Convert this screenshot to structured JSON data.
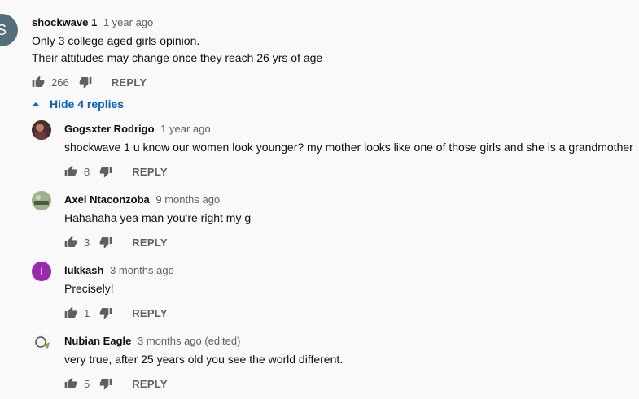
{
  "top_comment": {
    "avatar_letter": "S",
    "author": "shockwave 1",
    "time": "1 year ago",
    "lines": [
      "Only 3 college aged girls opinion.",
      "Their attitudes may change once they reach 26 yrs of age"
    ],
    "likes": "266",
    "reply_label": "REPLY"
  },
  "toggle": {
    "label": "Hide 4 replies",
    "icon": "chevron-up-icon"
  },
  "replies": [
    {
      "author": "Gogsxter Rodrigo",
      "time": "1 year ago",
      "text": "shockwave 1 u know our women look younger? my mother looks like one of those girls and she is a grandmother",
      "likes": "8",
      "reply_label": "REPLY",
      "avatar_color": "#3a2b2b"
    },
    {
      "author": "Axel Ntaconzoba",
      "time": "9 months ago",
      "text": "Hahahaha yea man you're right my g",
      "likes": "3",
      "reply_label": "REPLY",
      "avatar_color": "#8fa97a"
    },
    {
      "author": "lukkash",
      "time": "3 months ago",
      "text": "Precisely!",
      "likes": "1",
      "reply_label": "REPLY",
      "avatar_letter": "l",
      "avatar_color": "#9c27b0"
    },
    {
      "author": "Nubian Eagle",
      "time": "3 months ago (edited)",
      "text": "very true, after 25 years old you see the world different.",
      "likes": "5",
      "reply_label": "REPLY",
      "avatar_color": "#ffffff"
    }
  ],
  "colors": {
    "link": "#065fd4",
    "muted": "#606060",
    "background": "#f9f9f9"
  }
}
